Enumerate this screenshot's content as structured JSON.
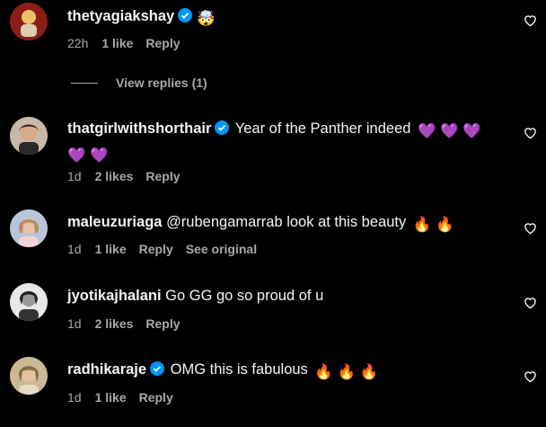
{
  "comments": [
    {
      "username": "thetyagiakshay",
      "verified": true,
      "text": "",
      "emoji": "🤯",
      "time": "22h",
      "likes": "1 like",
      "reply": "Reply",
      "extra": ""
    },
    {
      "username": "thatgirlwithshorthair",
      "verified": true,
      "text": "Year of the Panther indeed",
      "emoji": "💜 💜 💜",
      "emoji2": "💜 💜",
      "time": "1d",
      "likes": "2 likes",
      "reply": "Reply",
      "extra": ""
    },
    {
      "username": "maleuzuriaga",
      "verified": false,
      "text": "@rubengamarrab look at this beauty",
      "emoji": "🔥 🔥",
      "time": "1d",
      "likes": "1 like",
      "reply": "Reply",
      "extra": "See original"
    },
    {
      "username": "jyotikajhalani",
      "verified": false,
      "text": "Go GG go so proud of u",
      "emoji": "",
      "time": "1d",
      "likes": "2 likes",
      "reply": "Reply",
      "extra": ""
    },
    {
      "username": "radhikaraje",
      "verified": true,
      "text": "OMG this is fabulous",
      "emoji": "🔥 🔥 🔥",
      "time": "1d",
      "likes": "1 like",
      "reply": "Reply",
      "extra": ""
    }
  ],
  "view_replies": "View replies (1)",
  "colors": {
    "background": "#000000",
    "text": "#f5f5f5",
    "muted": "#a8a8a8",
    "verified": "#0095f6"
  }
}
